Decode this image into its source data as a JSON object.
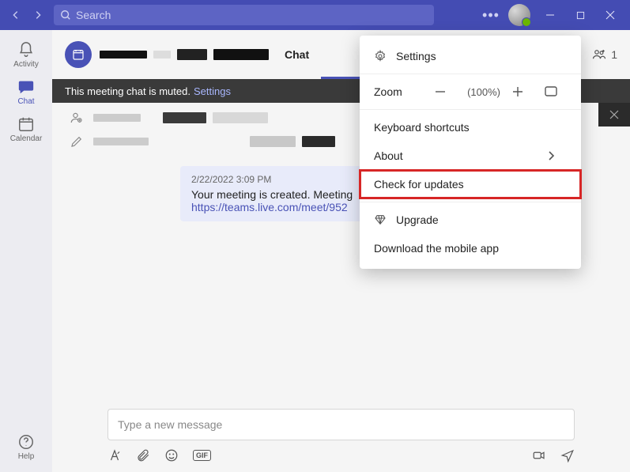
{
  "titlebar": {
    "search_placeholder": "Search"
  },
  "rail": {
    "activity": "Activity",
    "chat": "Chat",
    "calendar": "Calendar",
    "help": "Help"
  },
  "header": {
    "tab_chat": "Chat",
    "people_count": "1"
  },
  "banner": {
    "text": "This meeting chat is muted.",
    "link": "Settings"
  },
  "message": {
    "timestamp": "2/22/2022 3:09 PM",
    "body_pre": "Your meeting is created. Meeting",
    "link": "https://teams.live.com/meet/952"
  },
  "compose": {
    "placeholder": "Type a new message",
    "gif": "GIF"
  },
  "menu": {
    "settings": "Settings",
    "zoom": "Zoom",
    "zoom_value": "(100%)",
    "keyboard": "Keyboard shortcuts",
    "about": "About",
    "updates": "Check for updates",
    "upgrade": "Upgrade",
    "mobile": "Download the mobile app"
  }
}
